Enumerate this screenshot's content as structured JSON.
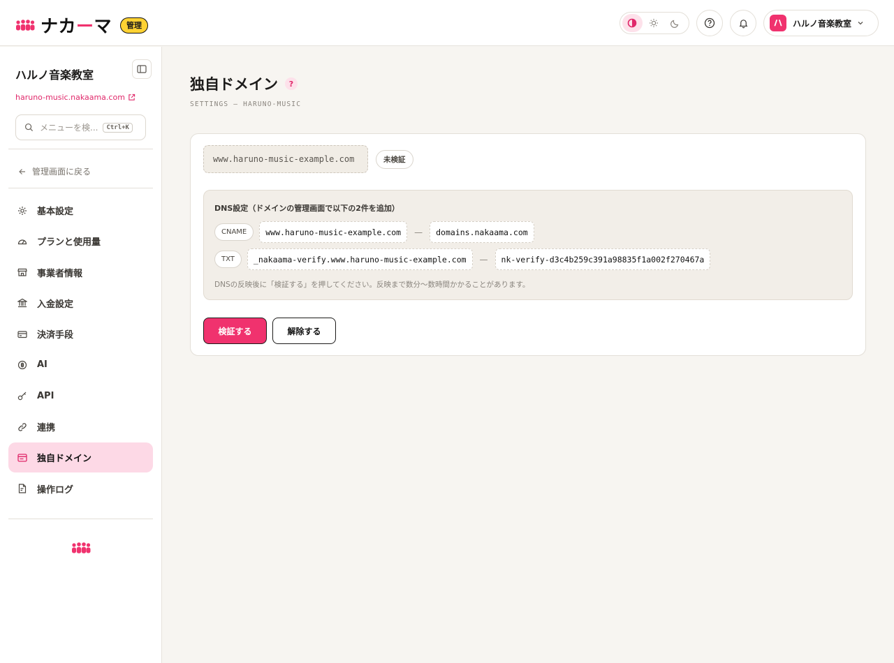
{
  "header": {
    "brand_name_prefix": "ナカ",
    "brand_name_accent": "ー",
    "brand_name_suffix": "マ",
    "admin_badge": "管理",
    "theme_modes": [
      "auto-icon",
      "sun-icon",
      "moon-icon"
    ],
    "account_avatar_glyph": "ハ",
    "account_name": "ハルノ音楽教室"
  },
  "sidebar": {
    "org_name": "ハルノ音楽教室",
    "site_link": "haruno-music.nakaama.com",
    "search_placeholder": "メニューを検...",
    "search_shortcut": "Ctrl+K",
    "back_label": "管理画面に戻る",
    "items": [
      {
        "label": "基本設定",
        "icon": "gear-icon",
        "active": false
      },
      {
        "label": "プランと使用量",
        "icon": "gauge-icon",
        "active": false
      },
      {
        "label": "事業者情報",
        "icon": "store-icon",
        "active": false
      },
      {
        "label": "入金設定",
        "icon": "bank-icon",
        "active": false
      },
      {
        "label": "決済手段",
        "icon": "credit-card-icon",
        "active": false
      },
      {
        "label": "AI",
        "icon": "ai-icon",
        "active": false
      },
      {
        "label": "API",
        "icon": "key-icon",
        "active": false
      },
      {
        "label": "連携",
        "icon": "link-icon",
        "active": false
      },
      {
        "label": "独自ドメイン",
        "icon": "browser-icon",
        "active": true
      },
      {
        "label": "操作ログ",
        "icon": "log-file-icon",
        "active": false
      }
    ]
  },
  "main": {
    "title": "独自ドメイン",
    "help_glyph": "?",
    "subtitle": "SETTINGS — HARUNO-MUSIC",
    "domain": "www.haruno-music-example.com",
    "status": "未検証",
    "dns": {
      "title": "DNS設定（ドメインの管理画面で以下の2件を追加）",
      "records": [
        {
          "type": "CNAME",
          "name": "www.haruno-music-example.com",
          "value": "domains.nakaama.com"
        },
        {
          "type": "TXT",
          "name": "_nakaama-verify.www.haruno-music-example.com",
          "value": "nk-verify-d3c4b259c391a98835f1a002f270467a"
        }
      ],
      "arrow": "—",
      "note": "DNSの反映後に「検証する」を押してください。反映まで数分〜数時間かかることがあります。"
    },
    "verify_button": "検証する",
    "remove_button": "解除する"
  },
  "colors": {
    "accent": "#f0326e",
    "badge_yellow": "#ffd233",
    "active_nav_bg": "#fdd9e6"
  }
}
